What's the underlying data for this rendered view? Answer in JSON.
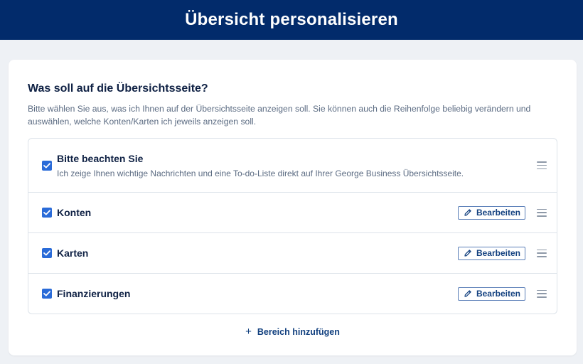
{
  "header": {
    "title": "Übersicht personalisieren"
  },
  "section": {
    "title": "Was soll auf die Übersichtsseite?",
    "description": "Bitte wählen Sie aus, was ich Ihnen auf der Übersichtsseite anzeigen soll. Sie können auch die Reihenfolge beliebig verändern und auswählen, welche Konten/Karten ich jeweils anzeigen soll."
  },
  "items": [
    {
      "label": "Bitte beachten Sie",
      "sub": "Ich zeige Ihnen wichtige Nachrichten und eine To-do-Liste direkt auf Ihrer George Business Übersichtsseite.",
      "checked": true
    },
    {
      "label": "Konten",
      "edit_label": "Bearbeiten",
      "checked": true
    },
    {
      "label": "Karten",
      "edit_label": "Bearbeiten",
      "checked": true
    },
    {
      "label": "Finanzierungen",
      "edit_label": "Bearbeiten",
      "checked": true
    }
  ],
  "add": {
    "icon": "plus-icon",
    "label": "Bereich hinzufügen"
  },
  "colors": {
    "header_bg": "#022b6b",
    "accent": "#2a6bd8",
    "link": "#12407f"
  }
}
